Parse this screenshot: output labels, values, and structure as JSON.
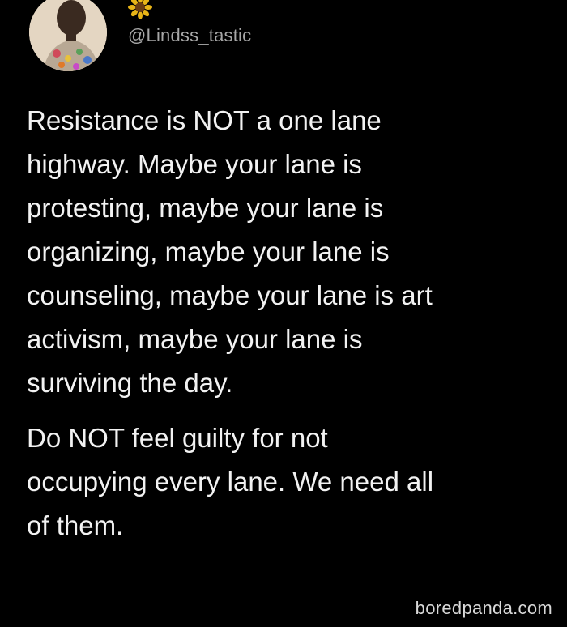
{
  "profile": {
    "handle": "@Lindss_tastic",
    "avatar_icon": "profile-photo-avatar",
    "badge_icon": "sunflower-icon"
  },
  "tweet": {
    "paragraph1": [
      "Resistance is NOT a one lane",
      "highway. Maybe your lane is",
      "protesting, maybe your lane is",
      "organizing, maybe your lane is",
      "counseling, maybe your lane is art",
      "activism, maybe your lane is",
      "surviving the day."
    ],
    "paragraph2": [
      "Do NOT feel guilty for not",
      "occupying every lane. We need all",
      "of them."
    ]
  },
  "watermark": {
    "text": "boredpanda.com"
  },
  "colors": {
    "background": "#000000",
    "text": "#f2f2f2",
    "handle": "#a7a7a7"
  }
}
